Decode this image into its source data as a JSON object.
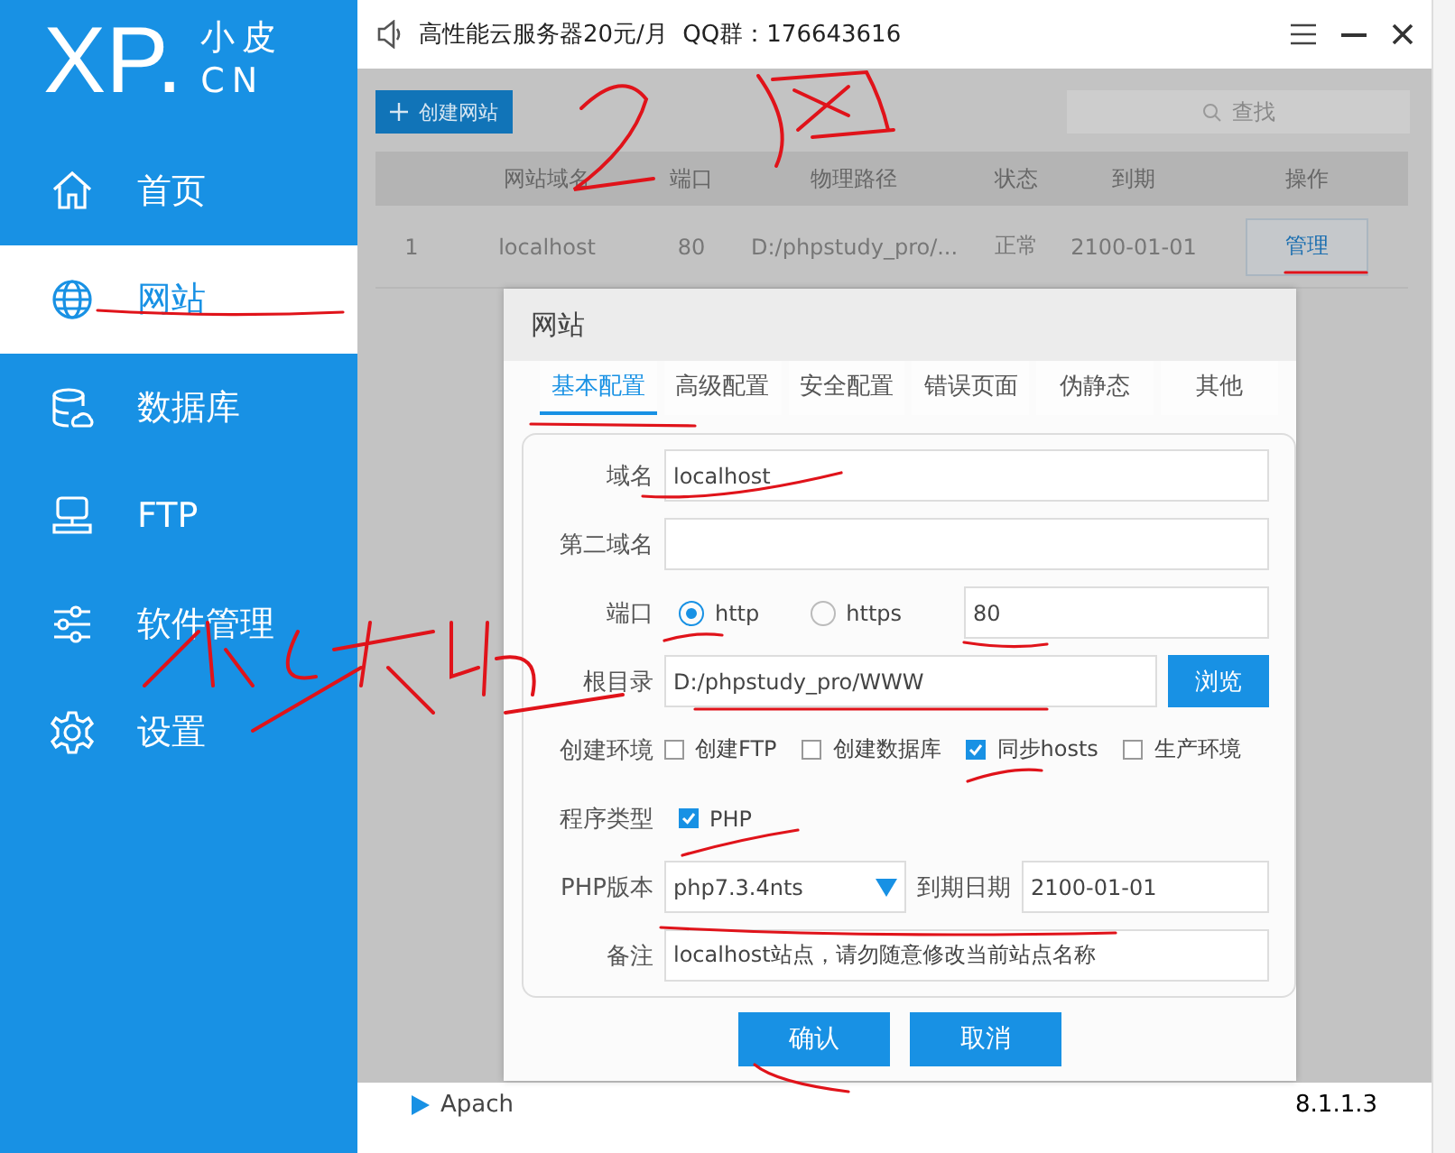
{
  "sidebar": {
    "logo": {
      "mark": "XP.",
      "top": "小皮",
      "bottom": "CN"
    },
    "items": [
      {
        "label": "首页",
        "selected": false
      },
      {
        "label": "网站",
        "selected": true
      },
      {
        "label": "数据库",
        "selected": false
      },
      {
        "label": "FTP",
        "selected": false
      },
      {
        "label": "软件管理",
        "selected": false
      },
      {
        "label": "设置",
        "selected": false
      }
    ]
  },
  "titlebar": {
    "notice": "高性能云服务器20元/月  QQ群：176643616"
  },
  "toolbar": {
    "create_button": "创建网站",
    "search": {
      "placeholder": "查找"
    }
  },
  "table": {
    "columns": [
      "",
      "网站域名",
      "端口",
      "物理路径",
      "状态",
      "到期",
      "操作"
    ],
    "rows": [
      {
        "cells": [
          "1",
          "localhost",
          "80",
          "D:/phpstudy_pro/...",
          "正常",
          "2100-01-01"
        ],
        "action": "管理"
      }
    ]
  },
  "dialog": {
    "title": "网站",
    "tabs": [
      {
        "label": "基本配置",
        "selected": true
      },
      {
        "label": "高级配置",
        "selected": false
      },
      {
        "label": "安全配置",
        "selected": false
      },
      {
        "label": "错误页面",
        "selected": false
      },
      {
        "label": "伪静态",
        "selected": false
      },
      {
        "label": "其他",
        "selected": false
      }
    ],
    "form": {
      "domain": {
        "label": "域名",
        "value": "localhost"
      },
      "second_domain": {
        "label": "第二域名"
      },
      "port": {
        "label": "端口",
        "options": [
          {
            "label": "http",
            "selected": true
          },
          {
            "label": "https",
            "selected": false
          }
        ],
        "value": "80"
      },
      "root": {
        "label": "根目录",
        "value": "D:/phpstudy_pro/WWW",
        "button": "浏览"
      },
      "environment": {
        "label": "创建环境",
        "options": [
          {
            "label": "创建FTP",
            "checked": false
          },
          {
            "label": "创建数据库",
            "checked": false
          },
          {
            "label": "同步hosts",
            "checked": true
          },
          {
            "label": "生产环境",
            "checked": false
          }
        ]
      },
      "program_type": {
        "label": "程序类型",
        "options": [
          {
            "label": "PHP",
            "checked": true
          }
        ]
      },
      "php_version": {
        "label": "PHP版本",
        "value": "php7.3.4nts"
      },
      "expiry": {
        "label": "到期日期",
        "value": "2100-01-01"
      },
      "note": {
        "label": "备注",
        "value": "localhost站点，请勿随意修改当前站点名称"
      }
    },
    "buttons": [
      "确认",
      "取消"
    ]
  },
  "status_bar": {
    "items": [
      "Apach",
      "8.1.1.3"
    ]
  }
}
